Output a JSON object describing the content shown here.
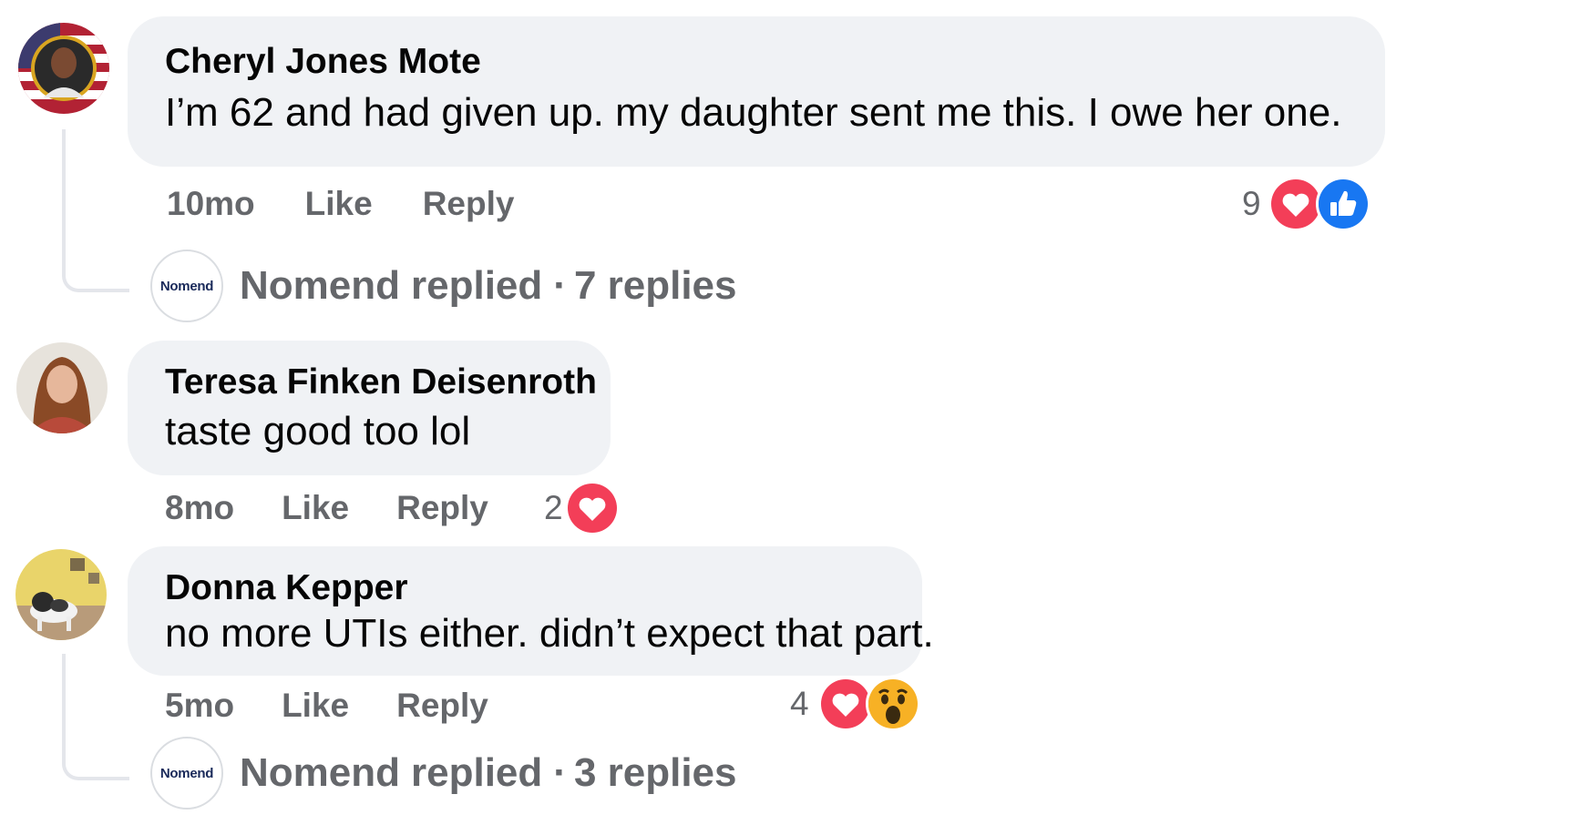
{
  "comments": [
    {
      "author": "Cheryl Jones Mote",
      "text": "I’m 62 and had given up. my daughter sent me this. I owe her one.",
      "time": "10mo",
      "like_label": "Like",
      "reply_label": "Reply",
      "reaction_count": "9",
      "reactions": [
        "heart-reaction-icon",
        "like-reaction-icon"
      ],
      "replies_summary": {
        "author": "Nomend",
        "replied_label": "replied",
        "separator": "·",
        "count_label": "7 replies"
      }
    },
    {
      "author": "Teresa Finken Deisenroth",
      "text": "taste good too lol",
      "time": "8mo",
      "like_label": "Like",
      "reply_label": "Reply",
      "reaction_count": "2",
      "reactions": [
        "heart-reaction-icon"
      ]
    },
    {
      "author": "Donna Kepper",
      "text": "no more UTIs either. didn’t expect that part.",
      "time": "5mo",
      "like_label": "Like",
      "reply_label": "Reply",
      "reaction_count": "4",
      "reactions": [
        "heart-reaction-icon",
        "wow-reaction-icon"
      ],
      "replies_summary": {
        "author": "Nomend",
        "replied_label": "replied",
        "separator": "·",
        "count_label": "3 replies"
      }
    }
  ],
  "nomend_avatar_label": "Nomend",
  "colors": {
    "bubble": "#f0f2f5",
    "secondary_text": "#65676b",
    "heart": "#f33e58",
    "like": "#1877f2",
    "wow": "#f7b125"
  }
}
